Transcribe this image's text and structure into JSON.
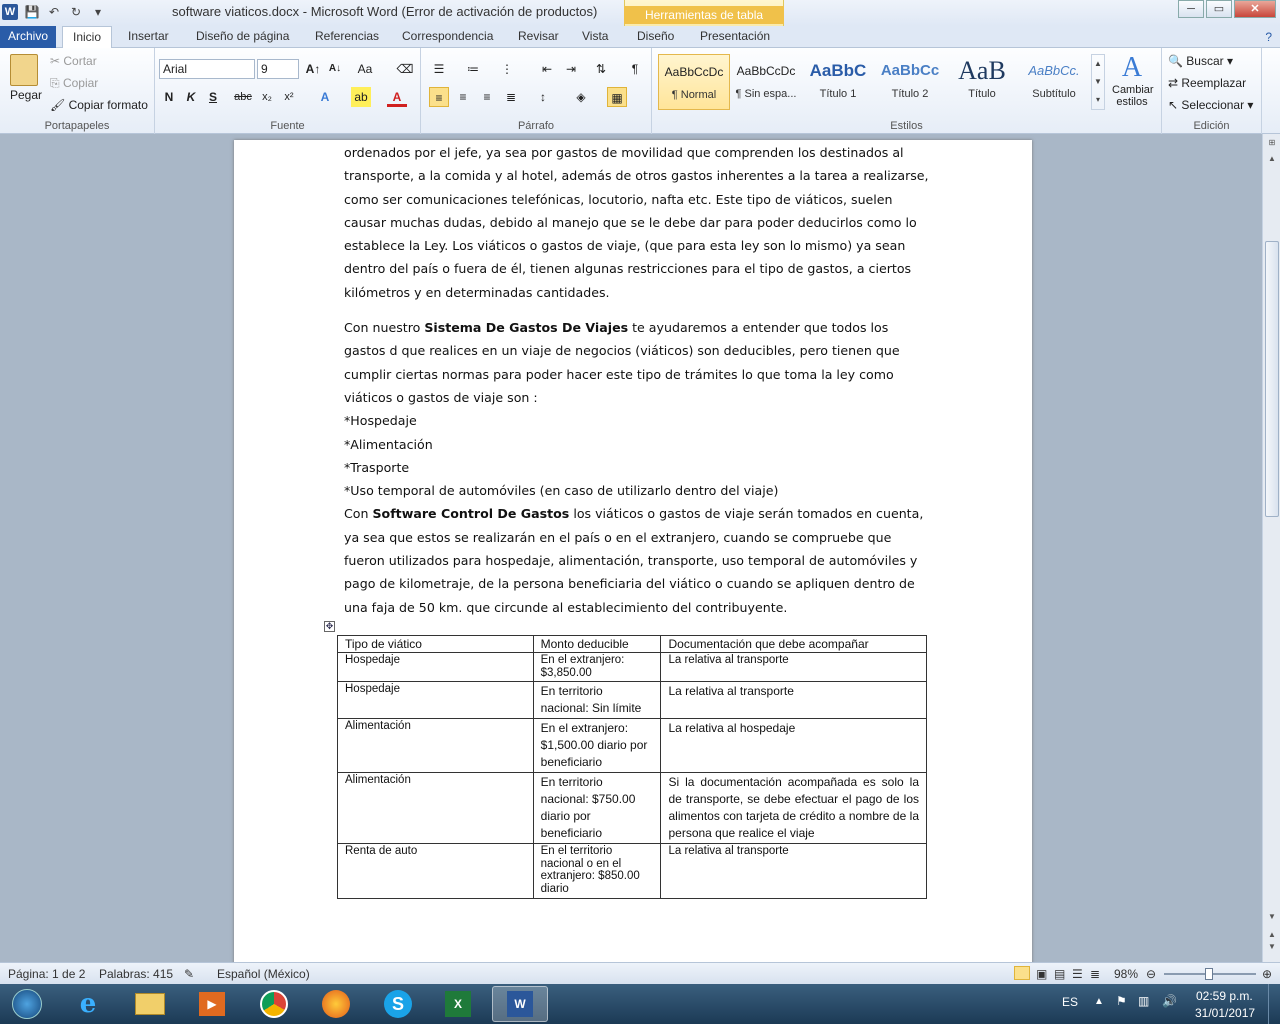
{
  "window": {
    "title": "software viaticos.docx  -  Microsoft Word (Error de activación de productos)",
    "context_group": "Herramientas de tabla",
    "app_icon": "W",
    "buttons": {
      "minimize": "─",
      "restore": "▭",
      "close": "✕"
    }
  },
  "ribbon_tabs": [
    "Archivo",
    "Inicio",
    "Insertar",
    "Diseño de página",
    "Referencias",
    "Correspondencia",
    "Revisar",
    "Vista",
    "Diseño",
    "Presentación"
  ],
  "clipboard": {
    "paste": "Pegar",
    "cut": "Cortar",
    "copy": "Copiar",
    "format_painter": "Copiar formato",
    "label": "Portapapeles"
  },
  "font": {
    "name": "Arial",
    "size": "9",
    "label": "Fuente"
  },
  "paragraph": {
    "label": "Párrafo"
  },
  "styles": {
    "label": "Estilos",
    "items": [
      {
        "preview": "AaBbCcDc",
        "name": "¶ Normal"
      },
      {
        "preview": "AaBbCcDc",
        "name": "¶ Sin espa..."
      },
      {
        "preview": "AaBbC",
        "name": "Título 1"
      },
      {
        "preview": "AaBbCc",
        "name": "Título 2"
      },
      {
        "preview": "AaB",
        "name": "Título"
      },
      {
        "preview": "AaBbCc.",
        "name": "Subtítulo"
      }
    ],
    "change": "Cambiar estilos"
  },
  "editing": {
    "find": "Buscar",
    "replace": "Reemplazar",
    "select": "Seleccionar",
    "label": "Edición"
  },
  "document": {
    "paragraphs": [
      "ordenados por el jefe, ya sea por gastos de movilidad que comprenden los destinados al transporte, a la comida y al hotel, además de otros gastos inherentes a la tarea a realizarse, como ser comunicaciones telefónicas, locutorio, nafta etc. Este tipo de viáticos, suelen causar muchas dudas, debido al manejo que se le debe dar para poder deducirlos como lo establece la Ley. Los viáticos o gastos de viaje, (que para esta ley son lo mismo) ya sean dentro del país o fuera de él, tienen algunas restricciones para el tipo de gastos, a ciertos kilómetros y en determinadas cantidades."
    ],
    "p2_pre": "Con nuestro ",
    "p2_bold": "Sistema De Gastos De Viajes",
    "p2_post": " te ayudaremos a  entender que todos los gastos d que realices en un viaje de negocios (viáticos) son deducibles, pero tienen que cumplir ciertas normas para poder hacer este tipo de trámites lo que toma la ley como viáticos o gastos de viaje son :",
    "list": [
      "*Hospedaje",
      "*Alimentación",
      "*Trasporte",
      "*Uso temporal de automóviles (en caso de utilizarlo dentro del viaje)"
    ],
    "p3_pre": "Con ",
    "p3_bold": "Software Control De Gastos",
    "p3_post": " los viáticos o gastos de viaje serán tomados en cuenta, ya sea que estos se realizarán en el país o en el extranjero, cuando se compruebe que fueron utilizados para hospedaje, alimentación, transporte, uso temporal de automóviles y pago de kilometraje, de la persona beneficiaria del viático o cuando se apliquen dentro de una faja de 50 km. que circunde al establecimiento del contribuyente."
  },
  "table": {
    "headers": [
      "Tipo de viático",
      "Monto deducible",
      "Documentación que debe acompañar"
    ],
    "rows": [
      [
        "Hospedaje",
        "En el extranjero: $3,850.00",
        "La relativa al transporte"
      ],
      [
        "Hospedaje",
        "En territorio nacional: Sin límite",
        "La relativa al transporte"
      ],
      [
        "Alimentación",
        "En el extranjero: $1,500.00 diario por beneficiario",
        "La relativa al hospedaje"
      ],
      [
        "Alimentación",
        "En territorio nacional: $750.00 diario por beneficiario",
        "Si la documentación acompañada es solo la de transporte, se debe efectuar el pago de los alimentos con tarjeta de crédito a nombre de la persona que realice el viaje"
      ],
      [
        "Renta de auto",
        "En el territorio nacional o en el extranjero: $850.00 diario",
        "La relativa al transporte"
      ]
    ]
  },
  "status": {
    "page": "Página: 1 de 2",
    "words": "Palabras: 415",
    "language": "Español (México)",
    "zoom": "98%",
    "zoom_level": 0.98
  },
  "taskbar": {
    "lang": "ES",
    "time": "02:59 p.m.",
    "date": "31/01/2017"
  }
}
